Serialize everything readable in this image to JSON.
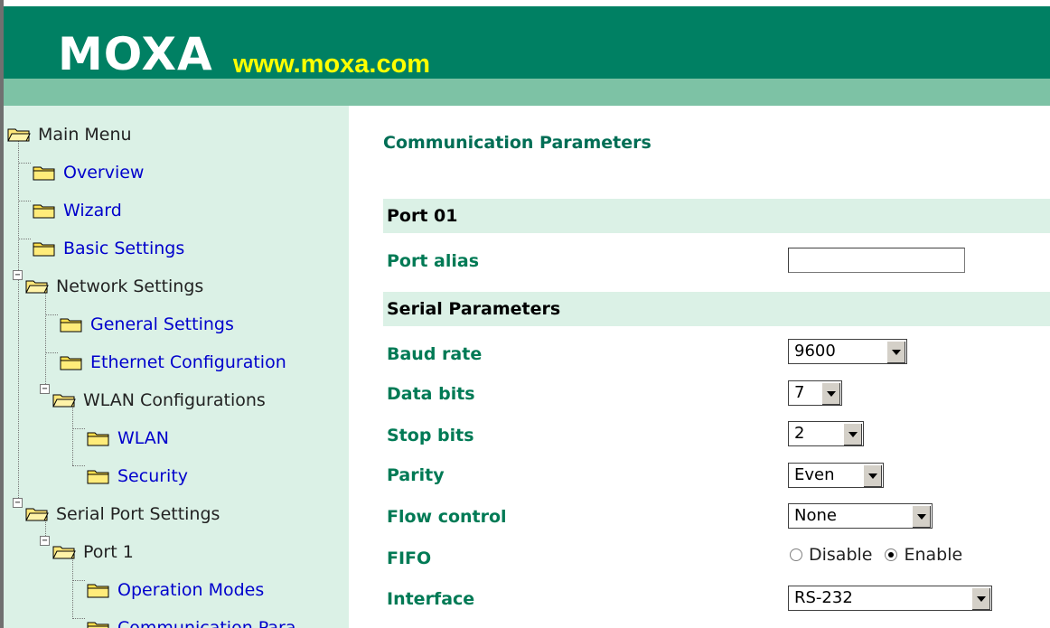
{
  "header": {
    "logo_text": "MOXA",
    "url": "www.moxa.com",
    "colors": {
      "top": "#008063",
      "bottom": "#7dc2a5",
      "url": "#ffff00"
    }
  },
  "sidebar": {
    "items": [
      {
        "label": "Main Menu",
        "type": "root",
        "icon": "open-folder-icon"
      },
      {
        "label": "Overview",
        "type": "link",
        "icon": "folder-icon"
      },
      {
        "label": "Wizard",
        "type": "link",
        "icon": "folder-icon"
      },
      {
        "label": "Basic Settings",
        "type": "link",
        "icon": "folder-icon"
      },
      {
        "label": "Network Settings",
        "type": "group",
        "icon": "open-folder-icon"
      },
      {
        "label": "General Settings",
        "type": "link",
        "icon": "folder-icon"
      },
      {
        "label": "Ethernet Configuration",
        "type": "link",
        "icon": "folder-icon"
      },
      {
        "label": "WLAN Configurations",
        "type": "group",
        "icon": "open-folder-icon"
      },
      {
        "label": "WLAN",
        "type": "link",
        "icon": "folder-icon"
      },
      {
        "label": "Security",
        "type": "link",
        "icon": "folder-icon"
      },
      {
        "label": "Serial Port Settings",
        "type": "group",
        "icon": "open-folder-icon"
      },
      {
        "label": "Port 1",
        "type": "group",
        "icon": "open-folder-icon"
      },
      {
        "label": "Operation Modes",
        "type": "link",
        "icon": "folder-icon"
      },
      {
        "label": "Communication Para",
        "type": "link",
        "icon": "folder-icon"
      }
    ]
  },
  "main": {
    "title": "Communication Parameters",
    "port_section": "Port 01",
    "port_alias": {
      "label": "Port alias",
      "value": ""
    },
    "serial_section": "Serial Parameters",
    "fields": {
      "baud_rate": {
        "label": "Baud rate",
        "value": "9600"
      },
      "data_bits": {
        "label": "Data bits",
        "value": "7"
      },
      "stop_bits": {
        "label": "Stop bits",
        "value": "2"
      },
      "parity": {
        "label": "Parity",
        "value": "Even"
      },
      "flow_control": {
        "label": "Flow control",
        "value": "None"
      },
      "fifo": {
        "label": "FIFO",
        "options": [
          "Disable",
          "Enable"
        ],
        "selected": "Enable"
      },
      "interface": {
        "label": "Interface",
        "value": "RS-232"
      }
    }
  }
}
